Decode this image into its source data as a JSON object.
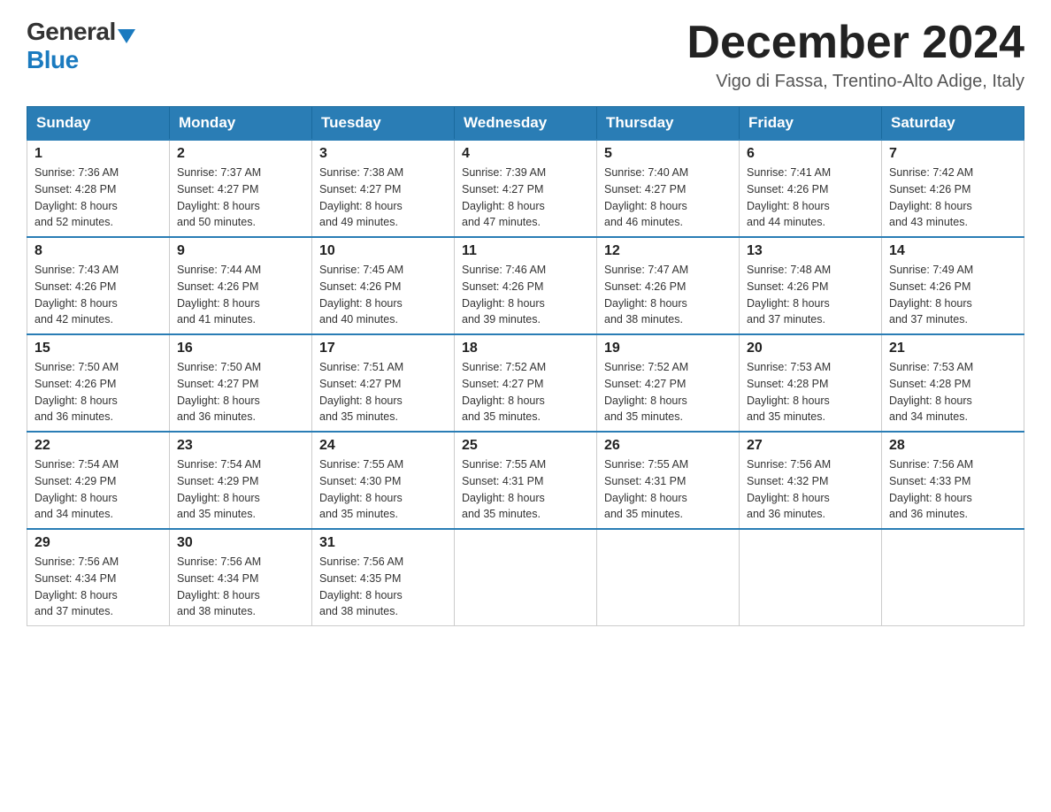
{
  "header": {
    "logo_general": "General",
    "logo_blue": "Blue",
    "main_title": "December 2024",
    "subtitle": "Vigo di Fassa, Trentino-Alto Adige, Italy"
  },
  "days_of_week": [
    "Sunday",
    "Monday",
    "Tuesday",
    "Wednesday",
    "Thursday",
    "Friday",
    "Saturday"
  ],
  "weeks": [
    [
      {
        "day": "1",
        "sunrise": "7:36 AM",
        "sunset": "4:28 PM",
        "daylight": "8 hours and 52 minutes."
      },
      {
        "day": "2",
        "sunrise": "7:37 AM",
        "sunset": "4:27 PM",
        "daylight": "8 hours and 50 minutes."
      },
      {
        "day": "3",
        "sunrise": "7:38 AM",
        "sunset": "4:27 PM",
        "daylight": "8 hours and 49 minutes."
      },
      {
        "day": "4",
        "sunrise": "7:39 AM",
        "sunset": "4:27 PM",
        "daylight": "8 hours and 47 minutes."
      },
      {
        "day": "5",
        "sunrise": "7:40 AM",
        "sunset": "4:27 PM",
        "daylight": "8 hours and 46 minutes."
      },
      {
        "day": "6",
        "sunrise": "7:41 AM",
        "sunset": "4:26 PM",
        "daylight": "8 hours and 44 minutes."
      },
      {
        "day": "7",
        "sunrise": "7:42 AM",
        "sunset": "4:26 PM",
        "daylight": "8 hours and 43 minutes."
      }
    ],
    [
      {
        "day": "8",
        "sunrise": "7:43 AM",
        "sunset": "4:26 PM",
        "daylight": "8 hours and 42 minutes."
      },
      {
        "day": "9",
        "sunrise": "7:44 AM",
        "sunset": "4:26 PM",
        "daylight": "8 hours and 41 minutes."
      },
      {
        "day": "10",
        "sunrise": "7:45 AM",
        "sunset": "4:26 PM",
        "daylight": "8 hours and 40 minutes."
      },
      {
        "day": "11",
        "sunrise": "7:46 AM",
        "sunset": "4:26 PM",
        "daylight": "8 hours and 39 minutes."
      },
      {
        "day": "12",
        "sunrise": "7:47 AM",
        "sunset": "4:26 PM",
        "daylight": "8 hours and 38 minutes."
      },
      {
        "day": "13",
        "sunrise": "7:48 AM",
        "sunset": "4:26 PM",
        "daylight": "8 hours and 37 minutes."
      },
      {
        "day": "14",
        "sunrise": "7:49 AM",
        "sunset": "4:26 PM",
        "daylight": "8 hours and 37 minutes."
      }
    ],
    [
      {
        "day": "15",
        "sunrise": "7:50 AM",
        "sunset": "4:26 PM",
        "daylight": "8 hours and 36 minutes."
      },
      {
        "day": "16",
        "sunrise": "7:50 AM",
        "sunset": "4:27 PM",
        "daylight": "8 hours and 36 minutes."
      },
      {
        "day": "17",
        "sunrise": "7:51 AM",
        "sunset": "4:27 PM",
        "daylight": "8 hours and 35 minutes."
      },
      {
        "day": "18",
        "sunrise": "7:52 AM",
        "sunset": "4:27 PM",
        "daylight": "8 hours and 35 minutes."
      },
      {
        "day": "19",
        "sunrise": "7:52 AM",
        "sunset": "4:27 PM",
        "daylight": "8 hours and 35 minutes."
      },
      {
        "day": "20",
        "sunrise": "7:53 AM",
        "sunset": "4:28 PM",
        "daylight": "8 hours and 35 minutes."
      },
      {
        "day": "21",
        "sunrise": "7:53 AM",
        "sunset": "4:28 PM",
        "daylight": "8 hours and 34 minutes."
      }
    ],
    [
      {
        "day": "22",
        "sunrise": "7:54 AM",
        "sunset": "4:29 PM",
        "daylight": "8 hours and 34 minutes."
      },
      {
        "day": "23",
        "sunrise": "7:54 AM",
        "sunset": "4:29 PM",
        "daylight": "8 hours and 35 minutes."
      },
      {
        "day": "24",
        "sunrise": "7:55 AM",
        "sunset": "4:30 PM",
        "daylight": "8 hours and 35 minutes."
      },
      {
        "day": "25",
        "sunrise": "7:55 AM",
        "sunset": "4:31 PM",
        "daylight": "8 hours and 35 minutes."
      },
      {
        "day": "26",
        "sunrise": "7:55 AM",
        "sunset": "4:31 PM",
        "daylight": "8 hours and 35 minutes."
      },
      {
        "day": "27",
        "sunrise": "7:56 AM",
        "sunset": "4:32 PM",
        "daylight": "8 hours and 36 minutes."
      },
      {
        "day": "28",
        "sunrise": "7:56 AM",
        "sunset": "4:33 PM",
        "daylight": "8 hours and 36 minutes."
      }
    ],
    [
      {
        "day": "29",
        "sunrise": "7:56 AM",
        "sunset": "4:34 PM",
        "daylight": "8 hours and 37 minutes."
      },
      {
        "day": "30",
        "sunrise": "7:56 AM",
        "sunset": "4:34 PM",
        "daylight": "8 hours and 38 minutes."
      },
      {
        "day": "31",
        "sunrise": "7:56 AM",
        "sunset": "4:35 PM",
        "daylight": "8 hours and 38 minutes."
      },
      null,
      null,
      null,
      null
    ]
  ],
  "labels": {
    "sunrise": "Sunrise:",
    "sunset": "Sunset:",
    "daylight": "Daylight:"
  }
}
